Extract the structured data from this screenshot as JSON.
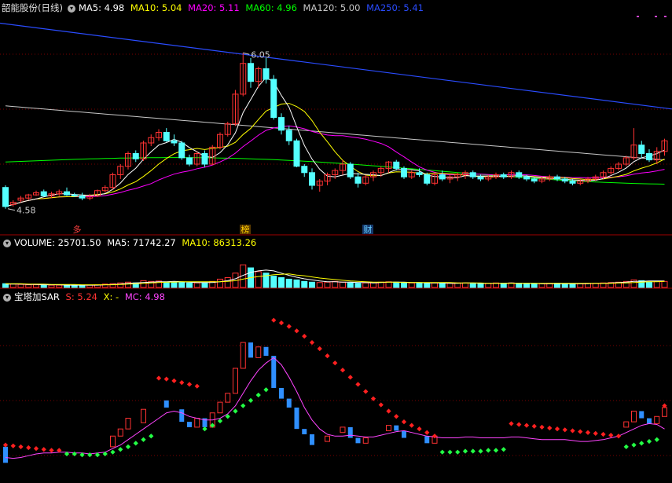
{
  "header": {
    "stock_name": "韶能股份(日线)",
    "ma5": "MA5: 4.98",
    "ma10": "MA10: 5.04",
    "ma20": "MA20: 5.11",
    "ma60": "MA60: 4.96",
    "ma120": "MA120: 5.00",
    "ma250": "MA250: 5.41",
    "toggle_icon": "chevron-down-icon"
  },
  "colors": {
    "up": "#ff3232",
    "down": "#54ffff",
    "ma5": "#ffffff",
    "ma10": "#ffff00",
    "ma20": "#ff00ff",
    "ma60": "#00ff00",
    "ma120": "#c8c8c8",
    "ma250": "#2a4cff",
    "sar_up": "#ff2020",
    "sar_down": "#22ff44",
    "sar_mc": "#ff44ff",
    "bar_blue": "#2f8fff",
    "grid": "#7a0000",
    "panel_border": "#a00000"
  },
  "price_chart": {
    "high_label": "6.05",
    "low_label": "4.58",
    "event_markers": [
      "多",
      "榜",
      "财"
    ]
  },
  "volume_header": {
    "volume": "VOLUME: 25701.50",
    "ma5": "MA5: 71742.27",
    "ma10": "MA10: 86313.26"
  },
  "sar_header": {
    "name": "宝塔加SAR",
    "s": "S: 5.24",
    "x": "X: -",
    "mc": "MC: 4.98"
  },
  "chart_data": [
    {
      "type": "candlestick",
      "title": "韶能股份(日线)",
      "y_range": [
        4.4,
        6.4
      ],
      "annotations": [
        {
          "label": "6.05",
          "kind": "high"
        },
        {
          "label": "4.58",
          "kind": "low"
        }
      ],
      "candles": [
        [
          4.78,
          4.8,
          4.58,
          4.6
        ],
        [
          4.62,
          4.66,
          4.6,
          4.64
        ],
        [
          4.66,
          4.7,
          4.64,
          4.68
        ],
        [
          4.68,
          4.72,
          4.66,
          4.71
        ],
        [
          4.71,
          4.75,
          4.7,
          4.73
        ],
        [
          4.74,
          4.76,
          4.69,
          4.7
        ],
        [
          4.7,
          4.74,
          4.68,
          4.72
        ],
        [
          4.72,
          4.76,
          4.7,
          4.74
        ],
        [
          4.74,
          4.78,
          4.7,
          4.71
        ],
        [
          4.71,
          4.73,
          4.69,
          4.7
        ],
        [
          4.7,
          4.73,
          4.66,
          4.68
        ],
        [
          4.68,
          4.72,
          4.66,
          4.7
        ],
        [
          4.7,
          4.76,
          4.69,
          4.75
        ],
        [
          4.75,
          4.8,
          4.73,
          4.78
        ],
        [
          4.78,
          4.92,
          4.76,
          4.9
        ],
        [
          4.9,
          5.0,
          4.86,
          4.98
        ],
        [
          4.98,
          5.12,
          4.95,
          5.1
        ],
        [
          5.1,
          5.13,
          5.02,
          5.05
        ],
        [
          5.05,
          5.22,
          5.03,
          5.2
        ],
        [
          5.2,
          5.28,
          5.17,
          5.25
        ],
        [
          5.25,
          5.33,
          5.22,
          5.3
        ],
        [
          5.3,
          5.34,
          5.21,
          5.22
        ],
        [
          5.22,
          5.28,
          5.17,
          5.2
        ],
        [
          5.2,
          5.22,
          5.04,
          5.06
        ],
        [
          5.06,
          5.09,
          4.98,
          5.0
        ],
        [
          5.0,
          5.12,
          4.98,
          5.1
        ],
        [
          5.1,
          5.13,
          4.97,
          5.0
        ],
        [
          5.0,
          5.18,
          4.99,
          5.16
        ],
        [
          5.16,
          5.3,
          5.14,
          5.28
        ],
        [
          5.28,
          5.4,
          5.26,
          5.38
        ],
        [
          5.38,
          5.7,
          5.36,
          5.66
        ],
        [
          5.66,
          6.05,
          5.64,
          5.95
        ],
        [
          5.95,
          6.0,
          5.72,
          5.78
        ],
        [
          5.78,
          5.92,
          5.72,
          5.9
        ],
        [
          5.9,
          6.0,
          5.76,
          5.8
        ],
        [
          5.8,
          5.84,
          5.42,
          5.44
        ],
        [
          5.44,
          5.48,
          5.28,
          5.32
        ],
        [
          5.32,
          5.36,
          5.18,
          5.22
        ],
        [
          5.22,
          5.24,
          4.97,
          4.98
        ],
        [
          4.98,
          5.0,
          4.88,
          4.92
        ],
        [
          4.92,
          4.96,
          4.76,
          4.8
        ],
        [
          4.8,
          4.86,
          4.74,
          4.84
        ],
        [
          4.84,
          4.92,
          4.8,
          4.9
        ],
        [
          4.9,
          4.96,
          4.86,
          4.94
        ],
        [
          4.94,
          5.04,
          4.9,
          5.0
        ],
        [
          5.0,
          5.02,
          4.86,
          4.88
        ],
        [
          4.88,
          4.92,
          4.78,
          4.82
        ],
        [
          4.82,
          4.9,
          4.8,
          4.88
        ],
        [
          4.88,
          4.94,
          4.84,
          4.92
        ],
        [
          4.92,
          4.98,
          4.88,
          4.96
        ],
        [
          4.96,
          5.03,
          4.92,
          5.02
        ],
        [
          5.02,
          5.04,
          4.94,
          4.96
        ],
        [
          4.96,
          4.98,
          4.86,
          4.88
        ],
        [
          4.88,
          4.94,
          4.86,
          4.92
        ],
        [
          4.92,
          4.96,
          4.88,
          4.9
        ],
        [
          4.9,
          4.92,
          4.8,
          4.82
        ],
        [
          4.82,
          4.92,
          4.8,
          4.9
        ],
        [
          4.9,
          4.94,
          4.84,
          4.86
        ],
        [
          4.86,
          4.9,
          4.82,
          4.88
        ],
        [
          4.88,
          4.92,
          4.84,
          4.9
        ],
        [
          4.9,
          4.94,
          4.86,
          4.92
        ],
        [
          4.92,
          4.94,
          4.86,
          4.88
        ],
        [
          4.88,
          4.9,
          4.84,
          4.86
        ],
        [
          4.86,
          4.9,
          4.84,
          4.88
        ],
        [
          4.88,
          4.92,
          4.86,
          4.9
        ],
        [
          4.9,
          4.92,
          4.86,
          4.88
        ],
        [
          4.88,
          4.94,
          4.86,
          4.92
        ],
        [
          4.92,
          4.94,
          4.86,
          4.88
        ],
        [
          4.88,
          4.9,
          4.84,
          4.86
        ],
        [
          4.86,
          4.88,
          4.82,
          4.84
        ],
        [
          4.84,
          4.88,
          4.82,
          4.86
        ],
        [
          4.86,
          4.9,
          4.84,
          4.88
        ],
        [
          4.88,
          4.9,
          4.84,
          4.86
        ],
        [
          4.86,
          4.88,
          4.82,
          4.84
        ],
        [
          4.84,
          4.86,
          4.8,
          4.82
        ],
        [
          4.82,
          4.86,
          4.8,
          4.84
        ],
        [
          4.84,
          4.88,
          4.82,
          4.86
        ],
        [
          4.86,
          4.9,
          4.84,
          4.88
        ],
        [
          4.88,
          4.94,
          4.86,
          4.92
        ],
        [
          4.92,
          4.98,
          4.9,
          4.96
        ],
        [
          4.96,
          5.02,
          4.94,
          5.0
        ],
        [
          5.0,
          5.08,
          4.98,
          5.06
        ],
        [
          5.06,
          5.34,
          5.04,
          5.18
        ],
        [
          5.18,
          5.22,
          5.06,
          5.1
        ],
        [
          5.1,
          5.14,
          5.02,
          5.04
        ],
        [
          5.04,
          5.16,
          5.0,
          5.12
        ],
        [
          5.12,
          5.24,
          5.08,
          5.22
        ]
      ]
    },
    {
      "type": "bar",
      "title": "VOLUME",
      "y_range": [
        0,
        100
      ],
      "values": [
        10,
        9,
        8,
        7,
        7,
        7,
        6,
        6,
        6,
        6,
        6,
        6,
        7,
        9,
        10,
        12,
        14,
        12,
        18,
        16,
        17,
        14,
        13,
        14,
        12,
        12,
        12,
        16,
        22,
        26,
        38,
        60,
        52,
        42,
        38,
        30,
        26,
        22,
        20,
        16,
        14,
        13,
        14,
        16,
        14,
        12,
        11,
        12,
        13,
        14,
        15,
        14,
        12,
        12,
        12,
        11,
        12,
        11,
        11,
        12,
        12,
        11,
        10,
        11,
        12,
        11,
        12,
        11,
        10,
        10,
        10,
        11,
        11,
        10,
        10,
        10,
        11,
        11,
        12,
        13,
        14,
        16,
        20,
        18,
        15,
        16,
        16
      ],
      "ma5": [
        9,
        9,
        9,
        8,
        8,
        7,
        7,
        7,
        6,
        6,
        6,
        6,
        6,
        7,
        8,
        9,
        11,
        12,
        13,
        14,
        15,
        15,
        16,
        15,
        14,
        13,
        13,
        13,
        15,
        18,
        23,
        32,
        40,
        44,
        46,
        44,
        38,
        32,
        27,
        23,
        20,
        17,
        15,
        15,
        14,
        14,
        13,
        13,
        12,
        13,
        14,
        14,
        14,
        13,
        13,
        12,
        12,
        12,
        11,
        11,
        12,
        12,
        11,
        11,
        11,
        11,
        12,
        11,
        11,
        11,
        10,
        10,
        10,
        10,
        10,
        10,
        10,
        11,
        11,
        12,
        13,
        14,
        16,
        16,
        17,
        17,
        17
      ],
      "ma10": [
        10,
        10,
        10,
        9,
        9,
        9,
        8,
        8,
        8,
        8,
        7,
        7,
        7,
        7,
        7,
        8,
        9,
        10,
        11,
        12,
        13,
        14,
        14,
        15,
        15,
        15,
        15,
        15,
        15,
        16,
        18,
        22,
        26,
        29,
        31,
        34,
        35,
        36,
        33,
        31,
        28,
        25,
        23,
        21,
        19,
        17,
        16,
        15,
        14,
        14,
        14,
        14,
        13,
        13,
        13,
        13,
        13,
        13,
        13,
        12,
        12,
        12,
        12,
        11,
        11,
        11,
        11,
        11,
        11,
        11,
        11,
        11,
        11,
        11,
        11,
        11,
        11,
        11,
        11,
        11,
        12,
        12,
        13,
        14,
        15,
        15,
        16
      ]
    },
    {
      "type": "bar",
      "title": "宝塔加SAR",
      "y_range": [
        4.4,
        6.4
      ],
      "series": [
        {
          "name": "S",
          "values": [
            4.8,
            4.79,
            4.78,
            4.77,
            4.76,
            4.75,
            4.74,
            4.74,
            null,
            null,
            null,
            null,
            null,
            null,
            null,
            null,
            null,
            null,
            null,
            null,
            5.55,
            5.54,
            5.52,
            5.5,
            5.48,
            5.46,
            null,
            null,
            null,
            null,
            null,
            null,
            null,
            null,
            null,
            6.2,
            6.17,
            6.13,
            6.08,
            6.02,
            5.95,
            5.88,
            5.8,
            5.72,
            5.64,
            5.56,
            5.48,
            5.4,
            5.32,
            5.25,
            5.18,
            5.12,
            5.06,
            5.02,
            4.98,
            4.94,
            4.9,
            null,
            null,
            null,
            null,
            null,
            null,
            null,
            null,
            null,
            5.04,
            5.03,
            5.02,
            5.01,
            5.0,
            4.99,
            4.98,
            4.97,
            4.96,
            4.95,
            4.94,
            4.93,
            4.92,
            4.91,
            4.9,
            null,
            null,
            null,
            null,
            null,
            5.24
          ]
        },
        {
          "name": "X",
          "values": [
            null,
            null,
            null,
            null,
            null,
            null,
            null,
            null,
            4.7,
            4.7,
            4.69,
            4.69,
            4.69,
            4.7,
            4.72,
            4.75,
            4.78,
            4.82,
            4.86,
            4.9,
            null,
            null,
            null,
            null,
            null,
            null,
            4.98,
            5.02,
            5.07,
            5.12,
            5.18,
            5.24,
            5.3,
            5.36,
            5.42,
            null,
            null,
            null,
            null,
            null,
            null,
            null,
            null,
            null,
            null,
            null,
            null,
            null,
            null,
            null,
            null,
            null,
            null,
            null,
            null,
            null,
            null,
            4.72,
            4.72,
            4.72,
            4.73,
            4.73,
            4.73,
            4.74,
            4.74,
            4.75,
            null,
            null,
            null,
            null,
            null,
            null,
            null,
            null,
            null,
            null,
            null,
            null,
            null,
            null,
            null,
            4.78,
            4.8,
            4.82,
            4.84,
            4.86,
            null
          ]
        },
        {
          "name": "MC",
          "values": [
            4.66,
            4.65,
            4.66,
            4.68,
            4.7,
            4.71,
            4.71,
            4.72,
            4.72,
            4.71,
            4.71,
            4.7,
            4.71,
            4.72,
            4.76,
            4.8,
            4.86,
            4.92,
            4.98,
            5.04,
            5.1,
            5.16,
            5.18,
            5.16,
            5.12,
            5.1,
            5.08,
            5.08,
            5.1,
            5.15,
            5.24,
            5.38,
            5.52,
            5.64,
            5.72,
            5.78,
            5.7,
            5.56,
            5.4,
            5.22,
            5.08,
            4.98,
            4.92,
            4.9,
            4.9,
            4.91,
            4.9,
            4.89,
            4.89,
            4.91,
            4.93,
            4.95,
            4.96,
            4.94,
            4.92,
            4.9,
            4.89,
            4.88,
            4.88,
            4.88,
            4.89,
            4.89,
            4.88,
            4.88,
            4.88,
            4.88,
            4.89,
            4.89,
            4.88,
            4.87,
            4.86,
            4.86,
            4.86,
            4.86,
            4.85,
            4.84,
            4.84,
            4.85,
            4.86,
            4.88,
            4.9,
            4.94,
            4.98,
            5.02,
            5.04,
            5.03,
            4.98
          ]
        }
      ]
    }
  ]
}
